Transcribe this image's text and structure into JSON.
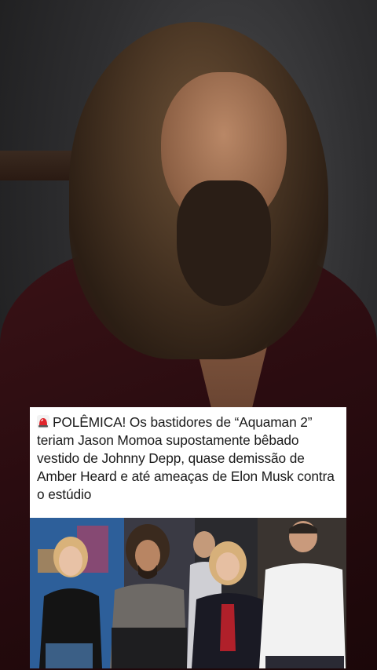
{
  "post": {
    "badge_icon": "siren-icon",
    "headline": "POLÊMICA! Os bastidores de “Aquaman 2” teriam Jason Momoa supostamente bêbado vestido de Johnny Depp, quase demissão de Amber Heard e até ameaças de Elon Musk contra o estúdio"
  },
  "colors": {
    "jacket": "#3a1216",
    "card_background": "#ffffff",
    "siren": "#e0252b"
  }
}
